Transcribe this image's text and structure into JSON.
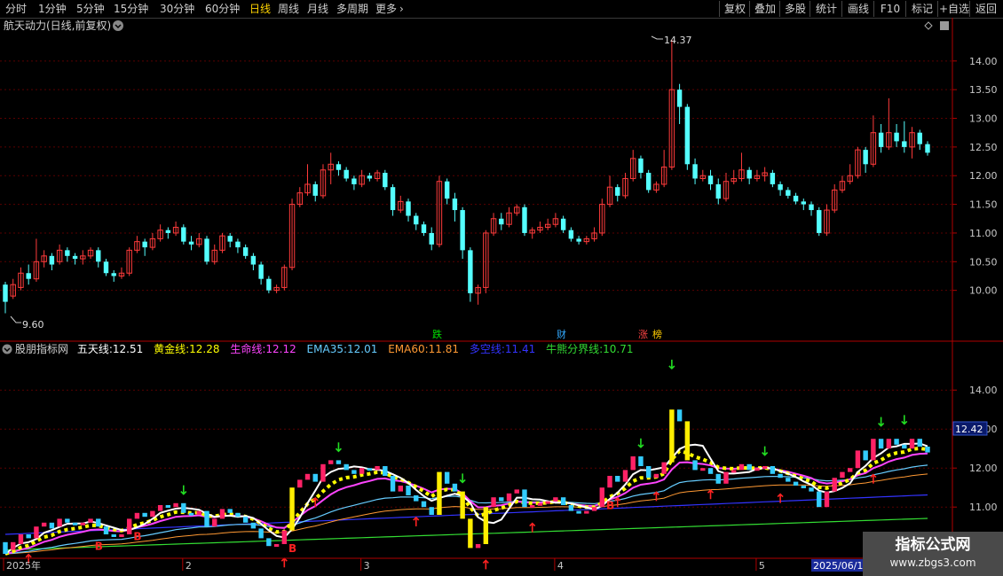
{
  "toolbar": {
    "left_tabs": [
      "分时",
      "1分钟",
      "5分钟",
      "15分钟",
      "30分钟",
      "60分钟",
      "日线",
      "周线",
      "月线",
      "多周期",
      "更多"
    ],
    "active_tab": "日线",
    "more_icon": "chevron-right-icon",
    "right_buttons": [
      "复权",
      "叠加",
      "多股",
      "统计",
      "画线",
      "F10",
      "标记",
      "+自选",
      "返回"
    ]
  },
  "main_panel": {
    "title": "航天动力(日线,前复权)",
    "title_dropdown_icon": "chevron-down-circle-icon",
    "high_label": "14.37",
    "low_label": "9.60",
    "price_ticks": [
      "14.00",
      "13.50",
      "13.00",
      "12.50",
      "12.00",
      "11.50",
      "11.00",
      "10.50",
      "10.00"
    ],
    "markers": [
      {
        "text": "跌",
        "color": "#00e000"
      },
      {
        "text": "财",
        "color": "#33aaff"
      },
      {
        "text": "涨",
        "color": "#ff4444"
      },
      {
        "text": "榜",
        "color": "#ffcc00"
      }
    ]
  },
  "indicator_panel": {
    "name": "股朋指标网",
    "items": [
      {
        "label": "五天线:",
        "value": "12.51",
        "color": "#ffffff"
      },
      {
        "label": "黄金线:",
        "value": "12.28",
        "color": "#ffff00"
      },
      {
        "label": "生命线:",
        "value": "12.12",
        "color": "#ff44ff"
      },
      {
        "label": "EMA35:",
        "value": "12.01",
        "color": "#66ccff"
      },
      {
        "label": "EMA60:",
        "value": "11.81",
        "color": "#ff9933"
      },
      {
        "label": "多空线:",
        "value": "11.41",
        "color": "#3333ff"
      },
      {
        "label": "牛熊分界线:",
        "value": "10.71",
        "color": "#33dd33"
      }
    ],
    "price_ticks": [
      "14.00",
      "13.00",
      "12.00",
      "11.00"
    ],
    "current_tag": "12.42",
    "b_label": "B"
  },
  "date_axis": {
    "labels": [
      "2025年",
      "2",
      "3",
      "4",
      "5",
      "6"
    ],
    "highlight": "2025/06/1"
  },
  "watermark": {
    "line1": "指标公式网",
    "line2": "www.zbgs3.com"
  },
  "chart_data": {
    "type": "candlestick",
    "title": "航天动力(日线,前复权)",
    "ylim": [
      9.5,
      14.6
    ],
    "period_high": 14.37,
    "period_low": 9.6,
    "candles": [
      [
        10.1,
        9.8,
        10.15,
        9.6
      ],
      [
        9.9,
        10.1,
        10.2,
        9.85
      ],
      [
        10.05,
        10.3,
        10.4,
        10.0
      ],
      [
        10.3,
        10.2,
        10.45,
        10.1
      ],
      [
        10.2,
        10.5,
        10.9,
        10.15
      ],
      [
        10.5,
        10.6,
        10.7,
        10.4
      ],
      [
        10.6,
        10.45,
        10.65,
        10.35
      ],
      [
        10.5,
        10.7,
        10.8,
        10.45
      ],
      [
        10.7,
        10.6,
        10.75,
        10.5
      ],
      [
        10.6,
        10.55,
        10.65,
        10.45
      ],
      [
        10.55,
        10.6,
        10.7,
        10.45
      ],
      [
        10.6,
        10.7,
        10.75,
        10.55
      ],
      [
        10.7,
        10.5,
        10.75,
        10.4
      ],
      [
        10.5,
        10.3,
        10.55,
        10.25
      ],
      [
        10.3,
        10.25,
        10.35,
        10.15
      ],
      [
        10.25,
        10.3,
        10.4,
        10.2
      ],
      [
        10.3,
        10.7,
        10.75,
        10.25
      ],
      [
        10.7,
        10.85,
        10.95,
        10.65
      ],
      [
        10.85,
        10.75,
        10.9,
        10.6
      ],
      [
        10.75,
        10.9,
        11.0,
        10.7
      ],
      [
        10.9,
        11.05,
        11.15,
        10.85
      ],
      [
        11.05,
        11.0,
        11.1,
        10.9
      ],
      [
        11.0,
        11.1,
        11.2,
        10.95
      ],
      [
        11.1,
        10.85,
        11.15,
        10.8
      ],
      [
        10.85,
        10.8,
        10.95,
        10.7
      ],
      [
        10.8,
        10.9,
        11.0,
        10.75
      ],
      [
        10.9,
        10.5,
        10.95,
        10.45
      ],
      [
        10.5,
        10.7,
        10.8,
        10.45
      ],
      [
        10.7,
        10.95,
        11.0,
        10.65
      ],
      [
        10.95,
        10.85,
        11.0,
        10.75
      ],
      [
        10.85,
        10.75,
        10.9,
        10.65
      ],
      [
        10.75,
        10.6,
        10.8,
        10.55
      ],
      [
        10.6,
        10.45,
        10.65,
        10.35
      ],
      [
        10.45,
        10.2,
        10.5,
        10.1
      ],
      [
        10.2,
        10.0,
        10.25,
        9.95
      ],
      [
        10.0,
        10.05,
        10.1,
        9.95
      ],
      [
        10.05,
        10.4,
        10.45,
        10.0
      ],
      [
        10.4,
        11.5,
        11.6,
        10.35
      ],
      [
        11.5,
        11.7,
        11.8,
        11.45
      ],
      [
        11.7,
        11.85,
        12.2,
        11.65
      ],
      [
        11.85,
        11.65,
        11.9,
        11.55
      ],
      [
        11.65,
        12.1,
        12.2,
        11.6
      ],
      [
        12.1,
        12.2,
        12.4,
        11.85
      ],
      [
        12.2,
        12.1,
        12.25,
        12.0
      ],
      [
        12.1,
        11.95,
        12.15,
        11.9
      ],
      [
        11.95,
        11.85,
        12.0,
        11.75
      ],
      [
        11.85,
        12.0,
        12.1,
        11.8
      ],
      [
        12.0,
        11.95,
        12.05,
        11.9
      ],
      [
        11.95,
        12.05,
        12.1,
        11.9
      ],
      [
        12.05,
        11.8,
        12.1,
        11.75
      ],
      [
        11.8,
        11.4,
        11.85,
        11.3
      ],
      [
        11.4,
        11.55,
        11.65,
        11.35
      ],
      [
        11.55,
        11.3,
        11.6,
        11.2
      ],
      [
        11.3,
        11.15,
        11.35,
        11.05
      ],
      [
        11.15,
        11.0,
        11.2,
        10.95
      ],
      [
        11.0,
        10.8,
        11.1,
        10.7
      ],
      [
        10.8,
        11.9,
        12.0,
        10.75
      ],
      [
        11.9,
        11.6,
        11.95,
        11.5
      ],
      [
        11.6,
        11.4,
        11.7,
        11.2
      ],
      [
        11.4,
        10.7,
        11.45,
        10.55
      ],
      [
        10.7,
        9.95,
        10.75,
        9.8
      ],
      [
        9.95,
        10.05,
        10.1,
        9.75
      ],
      [
        10.05,
        11.0,
        11.05,
        9.95
      ],
      [
        11.0,
        11.25,
        11.35,
        10.95
      ],
      [
        11.25,
        11.15,
        11.35,
        11.05
      ],
      [
        11.15,
        11.35,
        11.45,
        11.1
      ],
      [
        11.35,
        11.45,
        11.5,
        11.3
      ],
      [
        11.45,
        11.0,
        11.5,
        10.95
      ],
      [
        11.0,
        11.05,
        11.1,
        10.9
      ],
      [
        11.05,
        11.1,
        11.2,
        11.0
      ],
      [
        11.1,
        11.15,
        11.25,
        11.05
      ],
      [
        11.15,
        11.25,
        11.35,
        11.1
      ],
      [
        11.25,
        11.05,
        11.3,
        11.0
      ],
      [
        11.05,
        10.9,
        11.1,
        10.85
      ],
      [
        10.9,
        10.85,
        10.95,
        10.8
      ],
      [
        10.85,
        10.9,
        10.95,
        10.8
      ],
      [
        10.9,
        11.0,
        11.1,
        10.85
      ],
      [
        11.0,
        11.5,
        11.6,
        10.95
      ],
      [
        11.5,
        11.8,
        12.0,
        11.45
      ],
      [
        11.8,
        11.65,
        11.85,
        11.55
      ],
      [
        11.65,
        11.95,
        12.05,
        11.6
      ],
      [
        11.95,
        12.3,
        12.45,
        11.9
      ],
      [
        12.3,
        12.05,
        12.35,
        11.95
      ],
      [
        12.05,
        11.75,
        12.1,
        11.7
      ],
      [
        11.75,
        11.85,
        11.9,
        11.7
      ],
      [
        11.85,
        12.15,
        12.45,
        11.8
      ],
      [
        12.15,
        13.5,
        14.37,
        12.1
      ],
      [
        13.5,
        13.2,
        13.6,
        12.9
      ],
      [
        13.2,
        12.2,
        13.25,
        12.1
      ],
      [
        12.2,
        11.95,
        12.3,
        11.85
      ],
      [
        11.95,
        12.0,
        12.1,
        11.9
      ],
      [
        12.0,
        11.85,
        12.1,
        11.75
      ],
      [
        11.85,
        11.6,
        11.95,
        11.5
      ],
      [
        11.6,
        11.9,
        12.05,
        11.55
      ],
      [
        11.9,
        11.95,
        12.1,
        11.85
      ],
      [
        11.95,
        12.1,
        12.4,
        11.9
      ],
      [
        12.1,
        11.95,
        12.15,
        11.85
      ],
      [
        11.95,
        12.0,
        12.1,
        11.9
      ],
      [
        12.0,
        12.05,
        12.15,
        11.9
      ],
      [
        12.05,
        11.85,
        12.1,
        11.8
      ],
      [
        11.85,
        11.75,
        11.9,
        11.65
      ],
      [
        11.75,
        11.65,
        11.8,
        11.6
      ],
      [
        11.65,
        11.55,
        11.7,
        11.5
      ],
      [
        11.55,
        11.5,
        11.6,
        11.4
      ],
      [
        11.5,
        11.4,
        11.55,
        11.3
      ],
      [
        11.4,
        11.0,
        11.45,
        10.95
      ],
      [
        11.0,
        11.4,
        11.5,
        10.95
      ],
      [
        11.4,
        11.75,
        11.85,
        11.35
      ],
      [
        11.75,
        11.9,
        12.0,
        11.7
      ],
      [
        11.9,
        12.0,
        12.2,
        11.85
      ],
      [
        12.0,
        12.45,
        12.5,
        11.95
      ],
      [
        12.45,
        12.2,
        12.5,
        12.05
      ],
      [
        12.2,
        12.75,
        13.05,
        12.15
      ],
      [
        12.75,
        12.5,
        12.9,
        12.4
      ],
      [
        12.5,
        12.75,
        13.35,
        12.45
      ],
      [
        12.75,
        12.6,
        12.9,
        12.5
      ],
      [
        12.6,
        12.5,
        12.95,
        12.4
      ],
      [
        12.5,
        12.75,
        12.85,
        12.3
      ],
      [
        12.75,
        12.55,
        12.8,
        12.45
      ],
      [
        12.55,
        12.4,
        12.6,
        12.35
      ]
    ],
    "indicator": {
      "name": "股朋指标网",
      "series": [
        {
          "name": "五天线",
          "last": 12.51
        },
        {
          "name": "黄金线",
          "last": 12.28
        },
        {
          "name": "生命线",
          "last": 12.12
        },
        {
          "name": "EMA35",
          "last": 12.01
        },
        {
          "name": "EMA60",
          "last": 11.81
        },
        {
          "name": "多空线",
          "last": 11.41
        },
        {
          "name": "牛熊分界线",
          "last": 10.71
        }
      ],
      "ylim": [
        9.8,
        14.8
      ],
      "current": 12.42
    },
    "x_labels": [
      "2025年",
      "2",
      "3",
      "4",
      "5",
      "6"
    ],
    "x_label_positions": [
      0,
      23,
      46,
      71,
      97,
      121
    ],
    "highlight_date": "2025/06/1"
  }
}
